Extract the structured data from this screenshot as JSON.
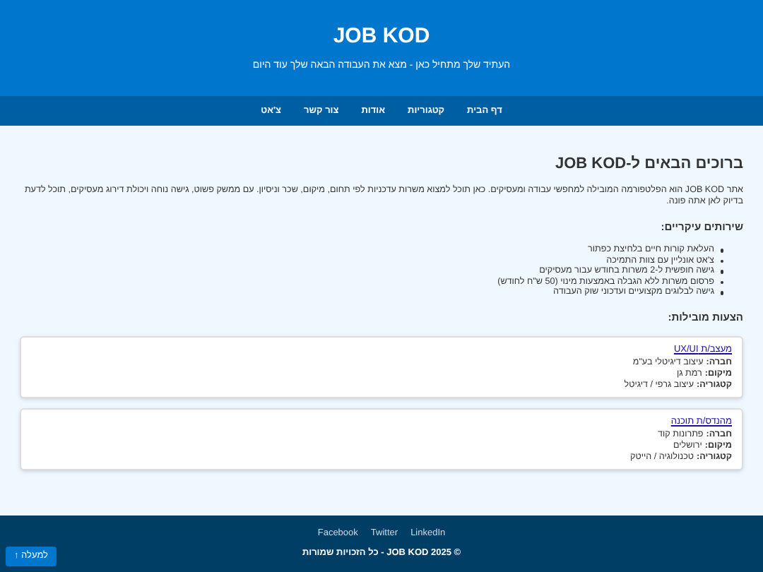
{
  "header": {
    "title": "JOB KOD",
    "tagline": "העתיד שלך מתחיל כאן - מצא את העבודה הבאה שלך עוד היום"
  },
  "nav": [
    "דף הבית",
    "קטגוריות",
    "אודות",
    "צור קשר",
    "צ'אט"
  ],
  "intro": {
    "heading": "ברוכים הבאים ל-JOB KOD",
    "paragraph": "אתר JOB KOD הוא הפלטפורמה המובילה למחפשי עבודה ומעסיקים. כאן תוכל למצוא משרות עדכניות לפי תחום, מיקום, שכר וניסיון. עם ממשק פשוט, גישה נוחה ויכולת דירוג מעסיקים, תוכל לדעת בדיוק לאן אתה פונה."
  },
  "services": {
    "heading": "שירותים עיקריים:",
    "items": [
      "העלאת קורות חיים בלחיצת כפתור",
      "צ'אט אונליין עם צוות התמיכה",
      "גישה חופשית ל-2 משרות בחודש עבור מעסיקים",
      "פרסום משרות ללא הגבלה באמצעות מינוי (50 ש\"ח לחודש)",
      "גישה לבלוגים מקצועיים ועדכוני שוק העבודה"
    ]
  },
  "featured": {
    "heading": "הצעות מובילות:",
    "jobs": [
      {
        "title": "מעצב/ת UX/UI",
        "fields": [
          {
            "label": "חברה:",
            "value": "עיצוב דיגיטלי בע\"מ"
          },
          {
            "label": "מיקום:",
            "value": "רמת גן"
          },
          {
            "label": "קטגוריה:",
            "value": "עיצוב גרפי / דיגיטל"
          }
        ]
      },
      {
        "title": "מהנדס/ת תוכנה",
        "fields": [
          {
            "label": "חברה:",
            "value": "פתרונות קוד"
          },
          {
            "label": "מיקום:",
            "value": "ירושלים"
          },
          {
            "label": "קטגוריה:",
            "value": "טכנולוגיה / הייטק"
          }
        ]
      }
    ]
  },
  "footer": {
    "links": [
      "LinkedIn",
      "Twitter",
      "Facebook"
    ],
    "copyright": "© JOB KOD 2025 - כל הזכויות שמורות"
  },
  "back_to_top": "למעלה ↑"
}
